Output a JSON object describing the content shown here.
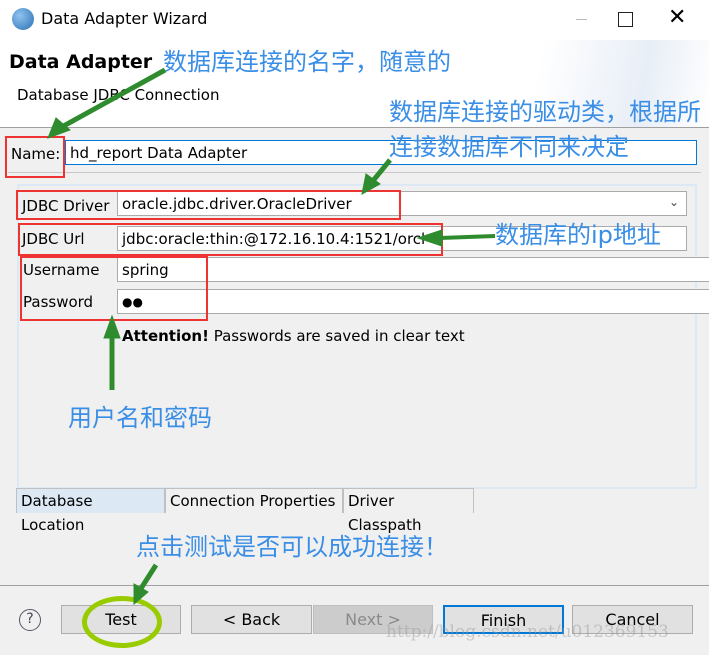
{
  "window": {
    "title": "Data Adapter Wizard"
  },
  "header": {
    "title": "Data Adapter",
    "subtitle": "Database JDBC Connection"
  },
  "form": {
    "name_label": "Name:",
    "name_value": "hd_report Data Adapter",
    "driver_label": "JDBC Driver",
    "driver_value": "oracle.jdbc.driver.OracleDriver",
    "url_label": "JDBC Url",
    "url_value": "jdbc:oracle:thin:@172.16.10.4:1521/orcl",
    "username_label": "Username",
    "username_value": "spring",
    "password_label": "Password",
    "password_value": "●●",
    "attention_bold": "Attention!",
    "attention_text": " Passwords are saved in clear text"
  },
  "tabs": [
    {
      "label": "Database Location",
      "active": true
    },
    {
      "label": "Connection Properties"
    },
    {
      "label": "Driver Classpath"
    }
  ],
  "buttons": {
    "help": "?",
    "test": "Test",
    "back": "< Back",
    "next": "Next >",
    "finish": "Finish",
    "cancel": "Cancel"
  },
  "annotations": {
    "name_note": "数据库连接的名字，随意的",
    "driver_note": "数据库连接的驱动类，根据所连接数据库不同来决定",
    "url_note": "数据库的ip地址",
    "credentials_note": "用户名和密码",
    "test_note": "点击测试是否可以成功连接！"
  },
  "watermark": "http://blog.csdn.net/u012369153",
  "colors": {
    "annotation_text": "#3a8ee6",
    "arrow": "#2e8b2e",
    "highlight_box": "#ee3333",
    "ellipse": "#99cc00",
    "focus": "#0078d7"
  }
}
